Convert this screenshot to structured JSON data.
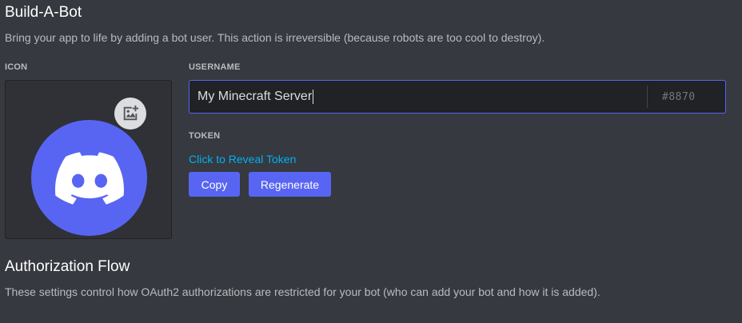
{
  "build_a_bot": {
    "title": "Build-A-Bot",
    "description": "Bring your app to life by adding a bot user. This action is irreversible (because robots are too cool to destroy).",
    "icon_label": "ICON",
    "icon_name": "discord-logo-icon",
    "upload_icon_name": "add-image-icon",
    "avatar_color": "#5865f2",
    "username_label": "USERNAME",
    "username_value": "My Minecraft Server",
    "discriminator": "#8870",
    "token_label": "TOKEN",
    "reveal_token_label": "Click to Reveal Token",
    "copy_label": "Copy",
    "regenerate_label": "Regenerate"
  },
  "authorization_flow": {
    "title": "Authorization Flow",
    "description": "These settings control how OAuth2 authorizations are restricted for your bot (who can add your bot and how it is added)."
  },
  "colors": {
    "background": "#36393f",
    "accent": "#5865f2",
    "link": "#00b0f4"
  }
}
